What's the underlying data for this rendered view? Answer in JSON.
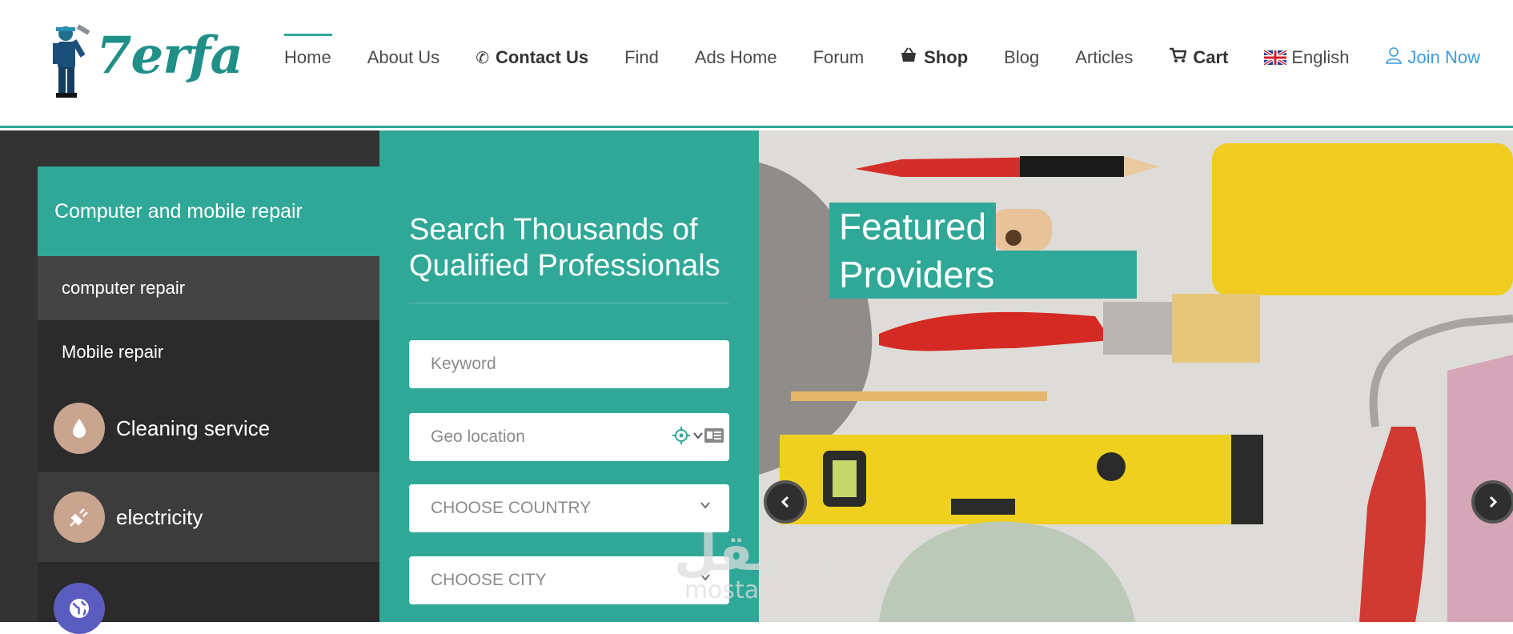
{
  "brand": {
    "name": "7erfa"
  },
  "nav": {
    "home": "Home",
    "about": "About Us",
    "contact": "Contact Us",
    "find": "Find",
    "ads_home": "Ads Home",
    "forum": "Forum",
    "shop": "Shop",
    "blog": "Blog",
    "articles": "Articles",
    "cart": "Cart",
    "language": "English",
    "join": "Join Now"
  },
  "sidebar": {
    "active_category": "Computer and mobile repair",
    "subitems": [
      "computer repair",
      "Mobile repair"
    ],
    "categories": [
      "Cleaning service",
      "electricity"
    ]
  },
  "search": {
    "title": "Search Thousands of Qualified Professionals",
    "keyword_placeholder": "Keyword",
    "geo_placeholder": "Geo location",
    "country": "CHOOSE COUNTRY",
    "city": "CHOOSE CITY"
  },
  "hero": {
    "line1": "Featured",
    "line2": "Providers"
  },
  "watermark": {
    "arabic": "مستقل",
    "latin": "mostaql.com"
  },
  "colors": {
    "accent": "#2fa897",
    "dark": "#333333",
    "link": "#3d9be0"
  }
}
